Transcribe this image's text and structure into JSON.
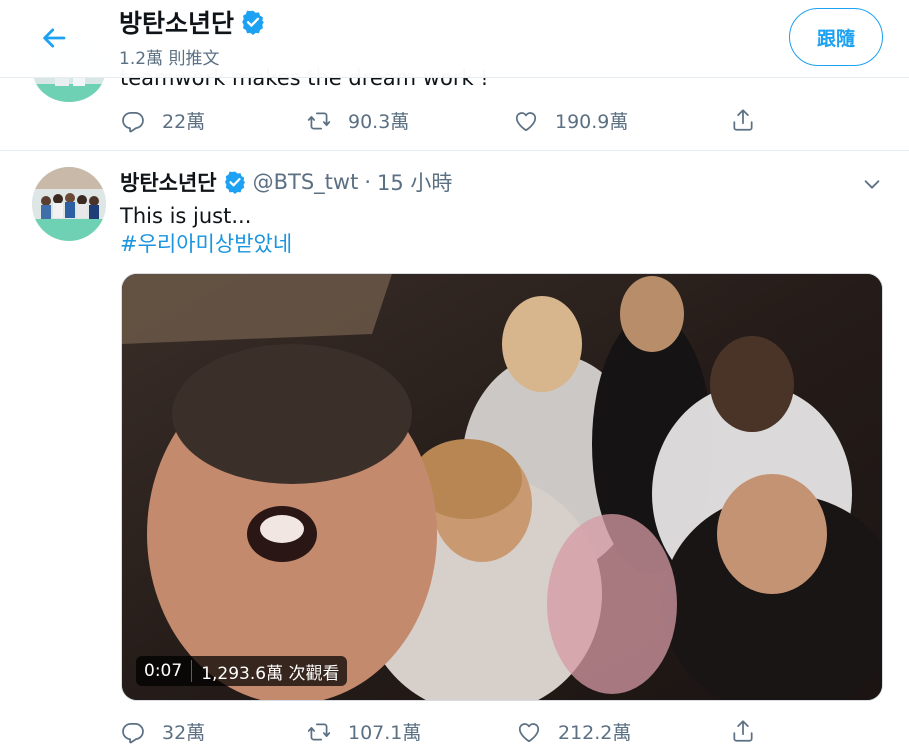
{
  "header": {
    "name": "방탄소년단",
    "tweet_count": "1.2萬 則推文",
    "follow_label": "跟隨"
  },
  "prev_tweet": {
    "text": "teamwork makes the dream work !",
    "replies": "22萬",
    "retweets": "90.3萬",
    "likes": "190.9萬"
  },
  "tweet": {
    "name": "방탄소년단",
    "handle": "@BTS_twt",
    "dot": "·",
    "time": "15 小時",
    "text": "This is just...",
    "hashtag": "#우리아미상받았네",
    "video": {
      "duration": "0:07",
      "views": "1,293.6萬 次觀看"
    },
    "replies": "32萬",
    "retweets": "107.1萬",
    "likes": "212.2萬"
  },
  "colors": {
    "accent": "#1da1f2",
    "verified": "#1da1f2",
    "muted": "#5b7083",
    "link": "#1b95e0"
  },
  "icons": [
    "back-arrow-icon",
    "verified-badge-icon",
    "reply-icon",
    "retweet-icon",
    "like-icon",
    "share-icon",
    "chevron-down-icon"
  ]
}
